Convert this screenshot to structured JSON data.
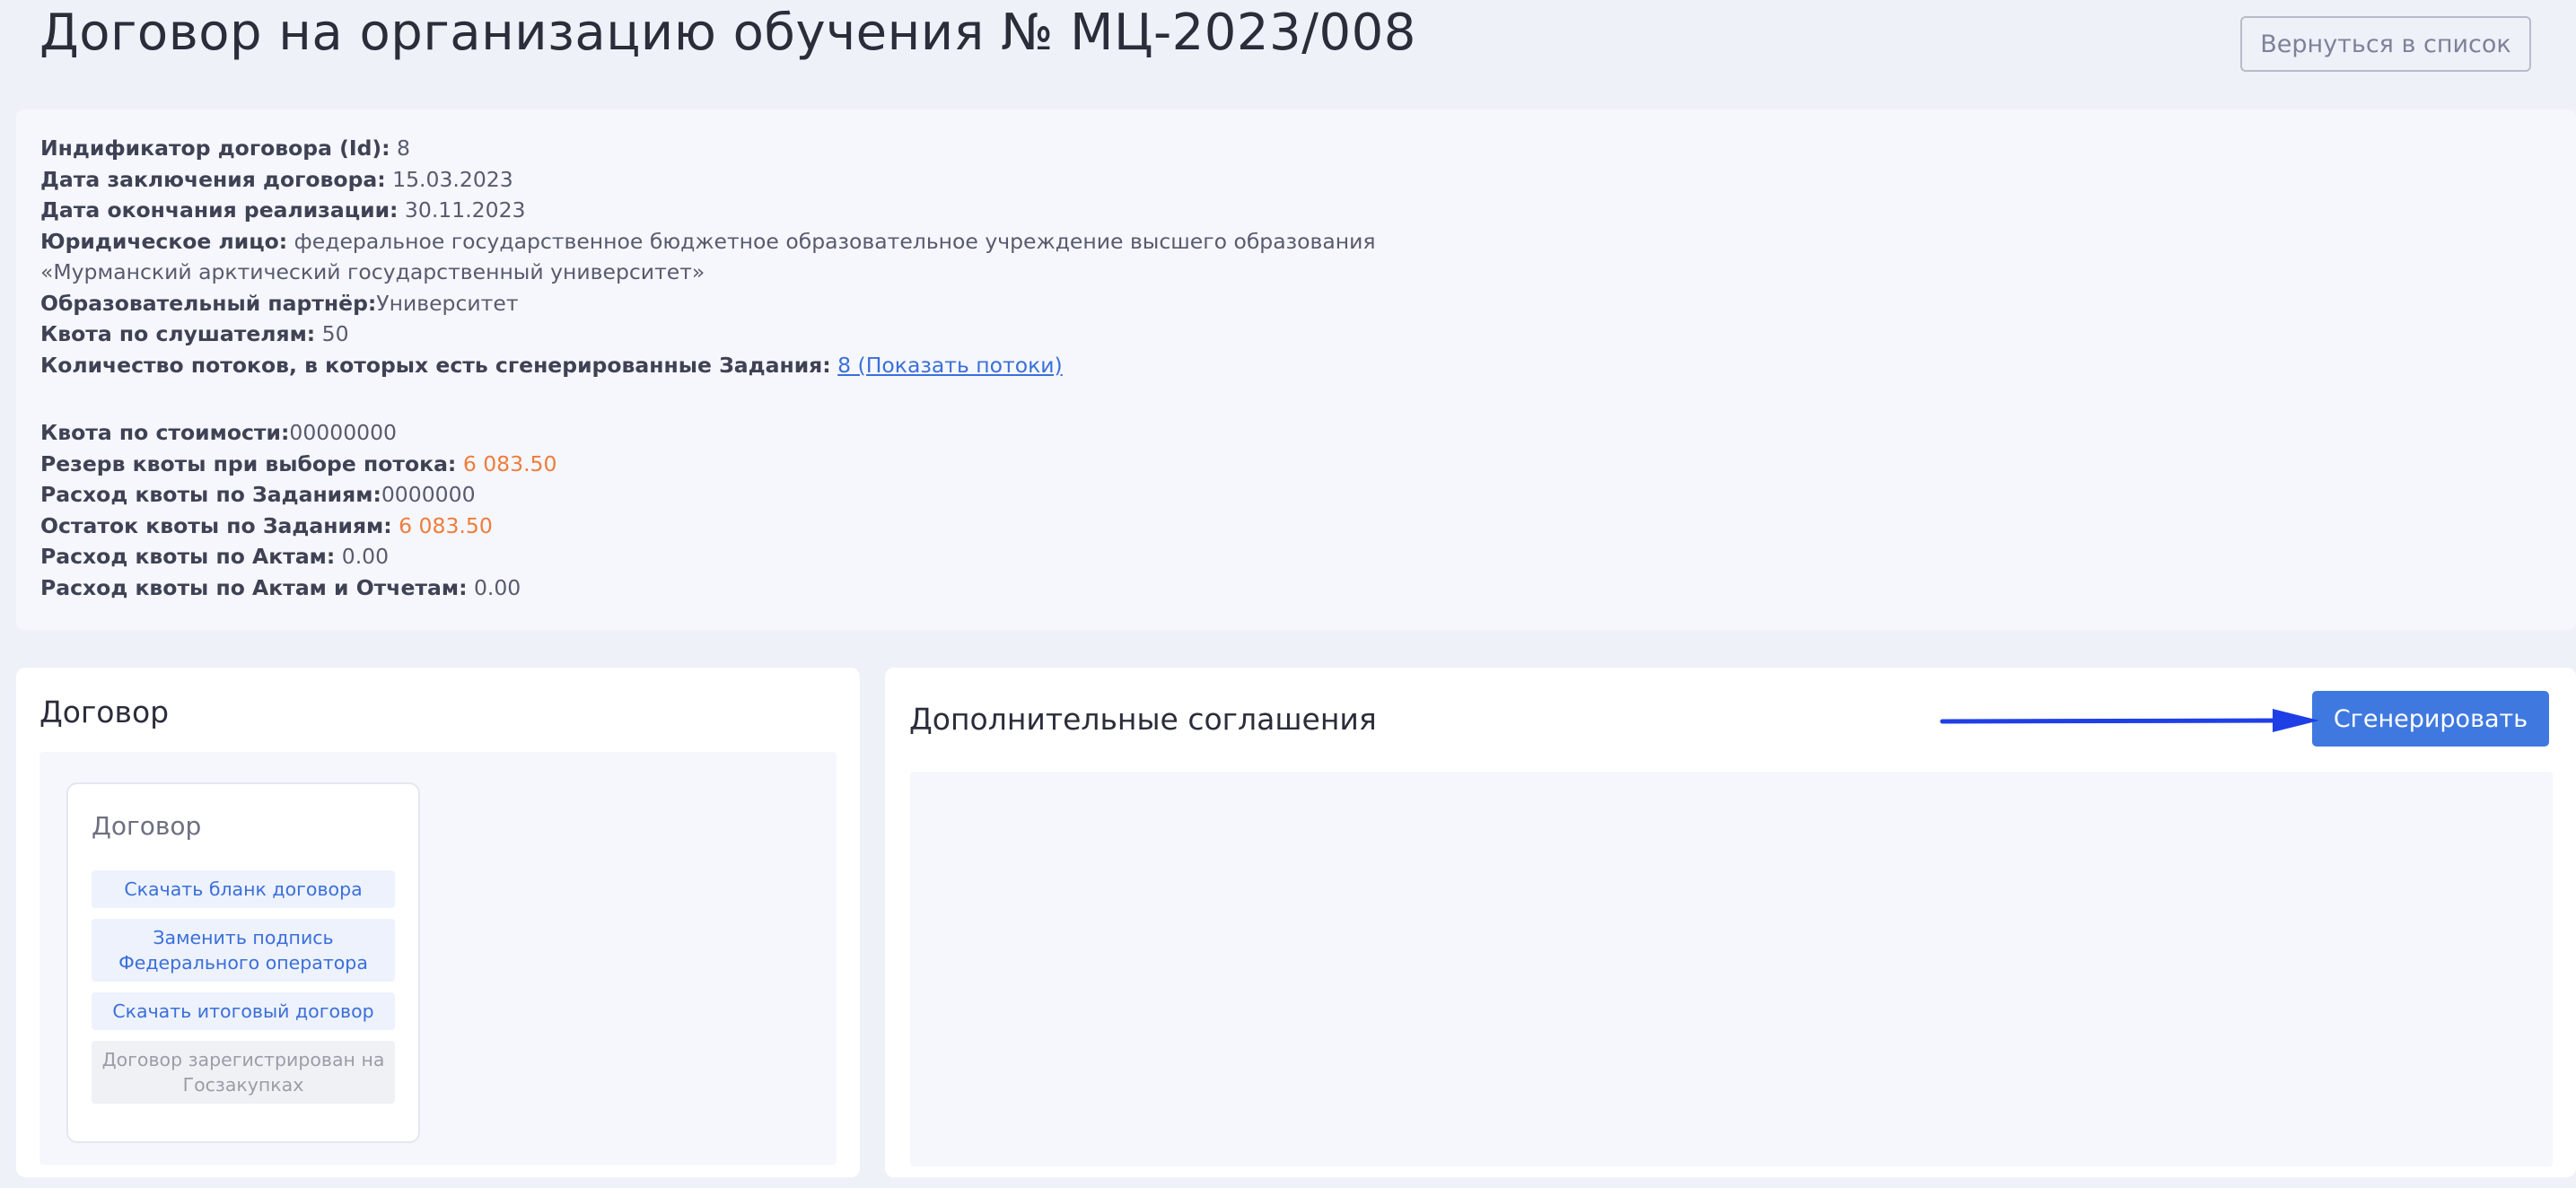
{
  "header": {
    "title": "Договор на организацию обучения № МЦ-2023/008",
    "back_label": "Вернуться в список"
  },
  "info": {
    "id_label": "Индификатор договора (Id):",
    "id_value": " 8",
    "date_label": "Дата заключения договора:",
    "date_value": " 15.03.2023",
    "end_label": "Дата окончания реализации:",
    "end_value": " 30.11.2023",
    "entity_label": "Юридическое лицо:",
    "entity_value": " федеральное государственное бюджетное образовательное учреждение высшего образования",
    "entity_value_2": "«Мурманский арктический государственный университет»",
    "partner_label": "Образовательный партнёр:",
    "partner_value": "Университет",
    "quota_label": "Квота по слушателям:",
    "quota_value": " 50",
    "streams_label": "Количество потоков, в которых есть сгенерированные Задания:",
    "streams_link": "8 (Показать потоки)",
    "cost_quota_label": "Квота по стоимости:",
    "cost_quota_value": "00000000",
    "reserve_label": "Резерв квоты при выборе потока:",
    "reserve_value": "6 083.50",
    "spend_tasks_label": "Расход квоты по Заданиям:",
    "spend_tasks_value": "0000000",
    "remain_tasks_label": "Остаток квоты по Заданиям:",
    "remain_tasks_value": "6 083.50",
    "spend_acts_label": "Расход квоты по Актам:",
    "spend_acts_value": " 0.00",
    "spend_acts_reports_label": "Расход квоты по Актам и Отчетам:",
    "spend_acts_reports_value": " 0.00"
  },
  "contract_panel": {
    "title": "Договор",
    "card_title": "Договор",
    "btn_download_blank": "Скачать бланк договора",
    "btn_replace_signature": "Заменить подпись Федерального оператора",
    "btn_download_final": "Скачать итоговый договор",
    "btn_registered": "Договор зарегистрирован на Госзакупках"
  },
  "agreements_panel": {
    "title": "Дополнительные соглашения",
    "generate_label": "Сгенерировать"
  },
  "colors": {
    "accent_orange": "#ee7c3c",
    "primary_blue": "#3f79e0",
    "arrow_blue": "#1f3fe6"
  }
}
